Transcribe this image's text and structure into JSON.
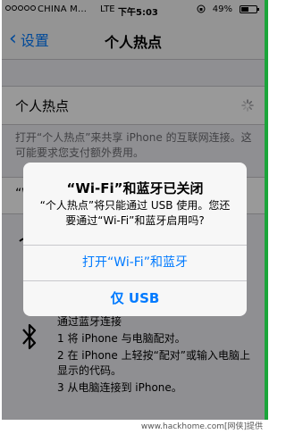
{
  "status_bar": {
    "carrier": "CHINA M...",
    "network": "LTE",
    "time": "下午5:03",
    "battery_percent": "49%",
    "battery_level": 0.49
  },
  "nav": {
    "back_label": "设置",
    "title": "个人热点"
  },
  "hotspot_row": {
    "label": "个人热点"
  },
  "hotspot_footer": "打开“个人热点”来共享 iPhone 的互联网连接。这可能要求您支付额外费用。",
  "partial_row_label": "“W",
  "instructions": {
    "header": "通过蓝牙连接",
    "steps": [
      "1 将 iPhone 与电脑配对。",
      "2 在 iPhone 上轻按“配对”或输入电脑上显示的代码。",
      "3 从电脑连接到 iPhone。"
    ]
  },
  "alert": {
    "title": "“Wi-Fi”和蓝牙已关闭",
    "message": "“个人热点”将只能通过 USB 使用。您还要通过“Wi-Fi”和蓝牙启用吗?",
    "primary_button": "打开“Wi-Fi”和蓝牙",
    "secondary_button": "仅 USB"
  },
  "watermark": "www.hackhome.com[网侠]提供",
  "colors": {
    "accent": "#007aff",
    "background": "#efeff4",
    "edge": "#1aa53a"
  }
}
